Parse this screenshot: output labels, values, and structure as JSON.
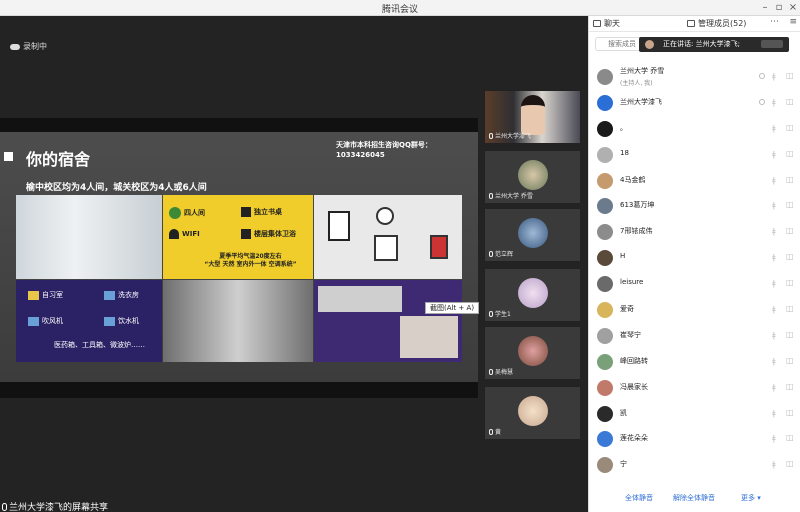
{
  "window": {
    "title": "腾讯会议"
  },
  "stage": {
    "recording_label": "录制中",
    "share_label": "兰州大学漆飞的屏幕共享",
    "screenshot_tip": "截图(Alt + A)"
  },
  "slide": {
    "heading": "你的宿舍",
    "subheading": "榆中校区均为4人间，城关校区为4人或6人间",
    "qq_line1": "天津市本科招生咨询QQ群号：",
    "qq_line2": "1033426045",
    "yellow_items": [
      "四人间",
      "独立书桌",
      "WIFI",
      "楼层集体卫浴"
    ],
    "yellow_note_line1": "夏季平均气温20度左右",
    "yellow_note_line2": "“大型 天然 室内外一体 空调系统”",
    "navy_items": [
      "自习室",
      "洗衣房",
      "吹风机",
      "饮水机"
    ],
    "navy_note": "医药箱、工具箱、微波炉……"
  },
  "thumbnails": [
    {
      "label": "兰州大学漆飞"
    },
    {
      "label": "兰州大学 乔雪"
    },
    {
      "label": "范立辉"
    },
    {
      "label": "学生1"
    },
    {
      "label": "吴梅慧"
    },
    {
      "label": "黄"
    }
  ],
  "sidebar": {
    "tab_chat": "聊天",
    "tab_members": "管理成员(52)",
    "search_placeholder": "搜索成员",
    "speaking": "正在讲话: 兰州大学漆飞;",
    "members": [
      {
        "name": "兰州大学 乔雪",
        "sub": "(主持人, 我)",
        "color": "#8a8a8a"
      },
      {
        "name": "兰州大学漆飞",
        "sub": "",
        "color": "#2b6fd6"
      },
      {
        "name": "。",
        "sub": "",
        "color": "#1a1a1a"
      },
      {
        "name": "18",
        "sub": "",
        "color": "#b0b0b0"
      },
      {
        "name": "4马金鹤",
        "sub": "",
        "color": "#c59a6d"
      },
      {
        "name": "613葛万坤",
        "sub": "",
        "color": "#6b7a8c"
      },
      {
        "name": "7邢铱成伟",
        "sub": "",
        "color": "#8c8c8c"
      },
      {
        "name": "H",
        "sub": "",
        "color": "#5a4a3a"
      },
      {
        "name": "leisure",
        "sub": "",
        "color": "#6a6a6a"
      },
      {
        "name": "爱奇",
        "sub": "",
        "color": "#d8b45a"
      },
      {
        "name": "崔琴宁",
        "sub": "",
        "color": "#a0a0a0"
      },
      {
        "name": "峰回路转",
        "sub": "",
        "color": "#7aa07a"
      },
      {
        "name": "冯晨家长",
        "sub": "",
        "color": "#c07a6a"
      },
      {
        "name": "凯",
        "sub": "",
        "color": "#2a2a2a"
      },
      {
        "name": "莲花朵朵",
        "sub": "",
        "color": "#3a7ad6"
      },
      {
        "name": "宁",
        "sub": "",
        "color": "#9a8a7a"
      }
    ],
    "footer": {
      "mute_all": "全体静音",
      "unmute_all": "解除全体静音",
      "more": "更多"
    }
  }
}
